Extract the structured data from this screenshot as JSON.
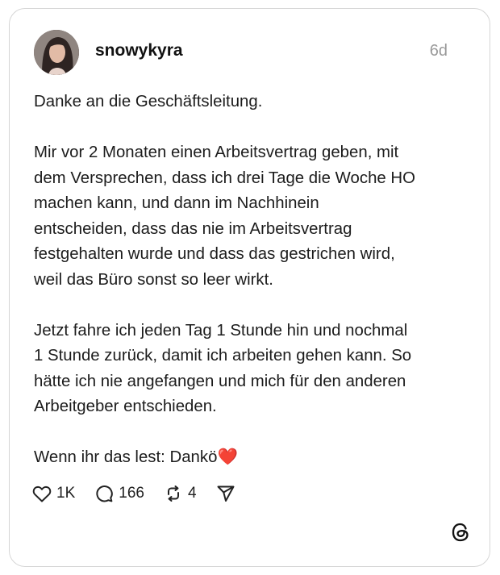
{
  "post": {
    "username": "snowykyra",
    "time": "6d",
    "paragraphs": [
      "Danke an die Geschäftsleitung.",
      "Mir vor 2 Monaten einen Arbeitsvertrag geben, mit\ndem Versprechen, dass ich drei Tage die Woche HO\nmachen kann, und dann im Nachhinein\nentscheiden, dass das nie im Arbeitsvertrag\nfestgehalten wurde und dass das gestrichen wird,\nweil das Büro sonst so leer wirkt.",
      "Jetzt fahre ich jeden Tag 1 Stunde hin und nochmal\n1 Stunde zurück, damit ich arbeiten gehen kann. So\nhätte ich nie angefangen und mich für den anderen\nArbeitgeber entschieden."
    ],
    "closing_text": "Wenn ihr das lest: Dankö",
    "closing_emoji": "❤️"
  },
  "actions": {
    "likes": "1K",
    "comments": "166",
    "reposts": "4"
  },
  "icons": {
    "like": "heart-icon",
    "comment": "comment-bubble-icon",
    "repost": "repost-icon",
    "share": "share-icon",
    "brand": "threads-logo-icon"
  },
  "colors": {
    "card_border": "#d6d6d6",
    "text": "#1c1c1c",
    "muted": "#9a9a9a",
    "heart_emoji": "#e0242b"
  }
}
